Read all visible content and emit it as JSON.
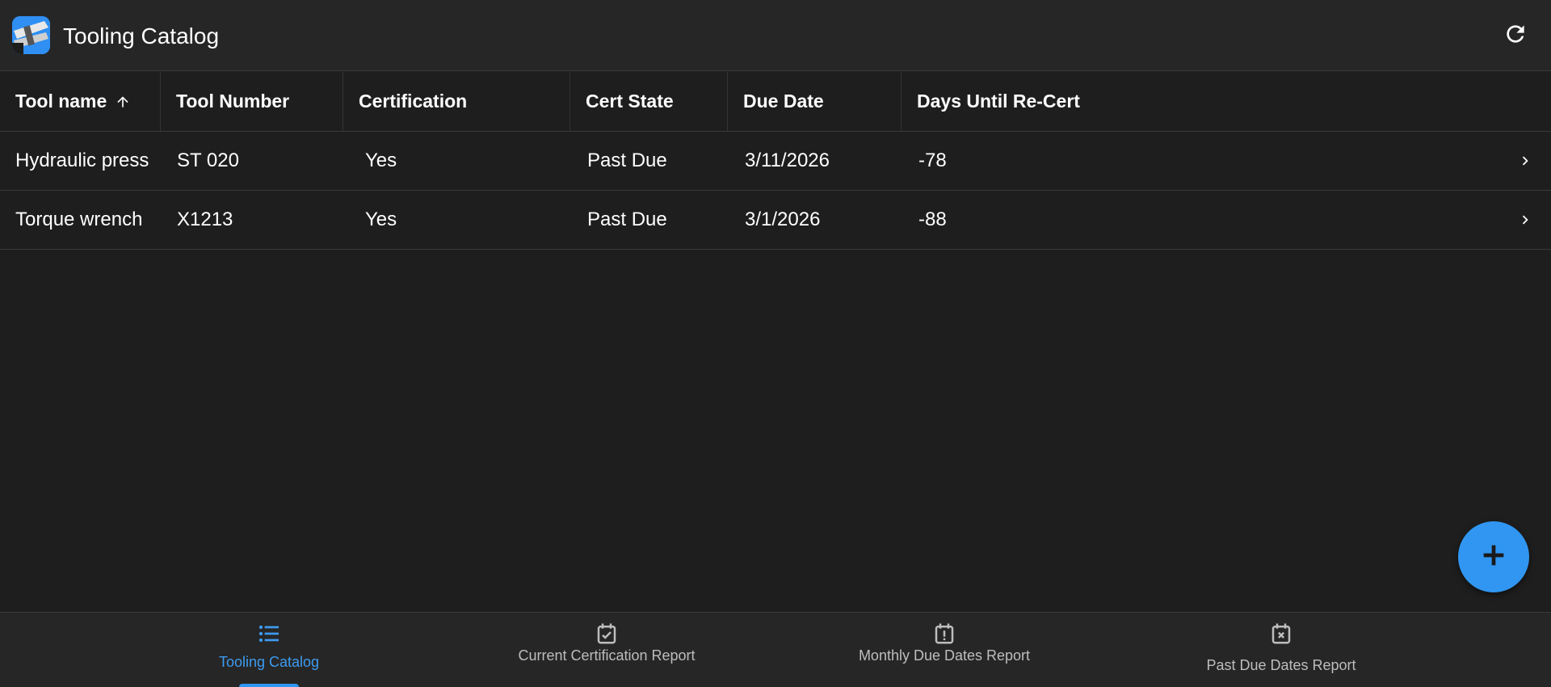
{
  "app": {
    "title": "Tooling Catalog",
    "logo_icon": "wrench-logo-icon",
    "refresh_icon": "refresh-icon",
    "accent_color": "#3096f2"
  },
  "table": {
    "columns": [
      {
        "label": "Tool name",
        "sorted": "ascending",
        "sort_icon": "arrow-up-icon"
      },
      {
        "label": "Tool Number"
      },
      {
        "label": "Certification"
      },
      {
        "label": "Cert State"
      },
      {
        "label": "Due Date"
      },
      {
        "label": "Days Until Re-Cert"
      }
    ],
    "rows": [
      {
        "tool_name": "Hydraulic press",
        "tool_number": "ST 020",
        "certification": "Yes",
        "cert_state": "Past Due",
        "due_date": "3/11/2026",
        "days_until_recert": "-78"
      },
      {
        "tool_name": "Torque wrench",
        "tool_number": "X1213",
        "certification": "Yes",
        "cert_state": "Past Due",
        "due_date": "3/1/2026",
        "days_until_recert": "-88"
      }
    ],
    "row_action_icon": "chevron-right-icon"
  },
  "fab": {
    "icon": "plus-icon"
  },
  "bottom_nav": {
    "items": [
      {
        "label": "Tooling Catalog",
        "icon": "list-icon",
        "active": true
      },
      {
        "label": "Current Certification Report",
        "icon": "calendar-check-icon",
        "active": false
      },
      {
        "label": "Monthly Due Dates Report",
        "icon": "calendar-alert-icon",
        "active": false
      },
      {
        "label": "Past Due Dates Report",
        "icon": "calendar-x-icon",
        "active": false
      }
    ]
  }
}
